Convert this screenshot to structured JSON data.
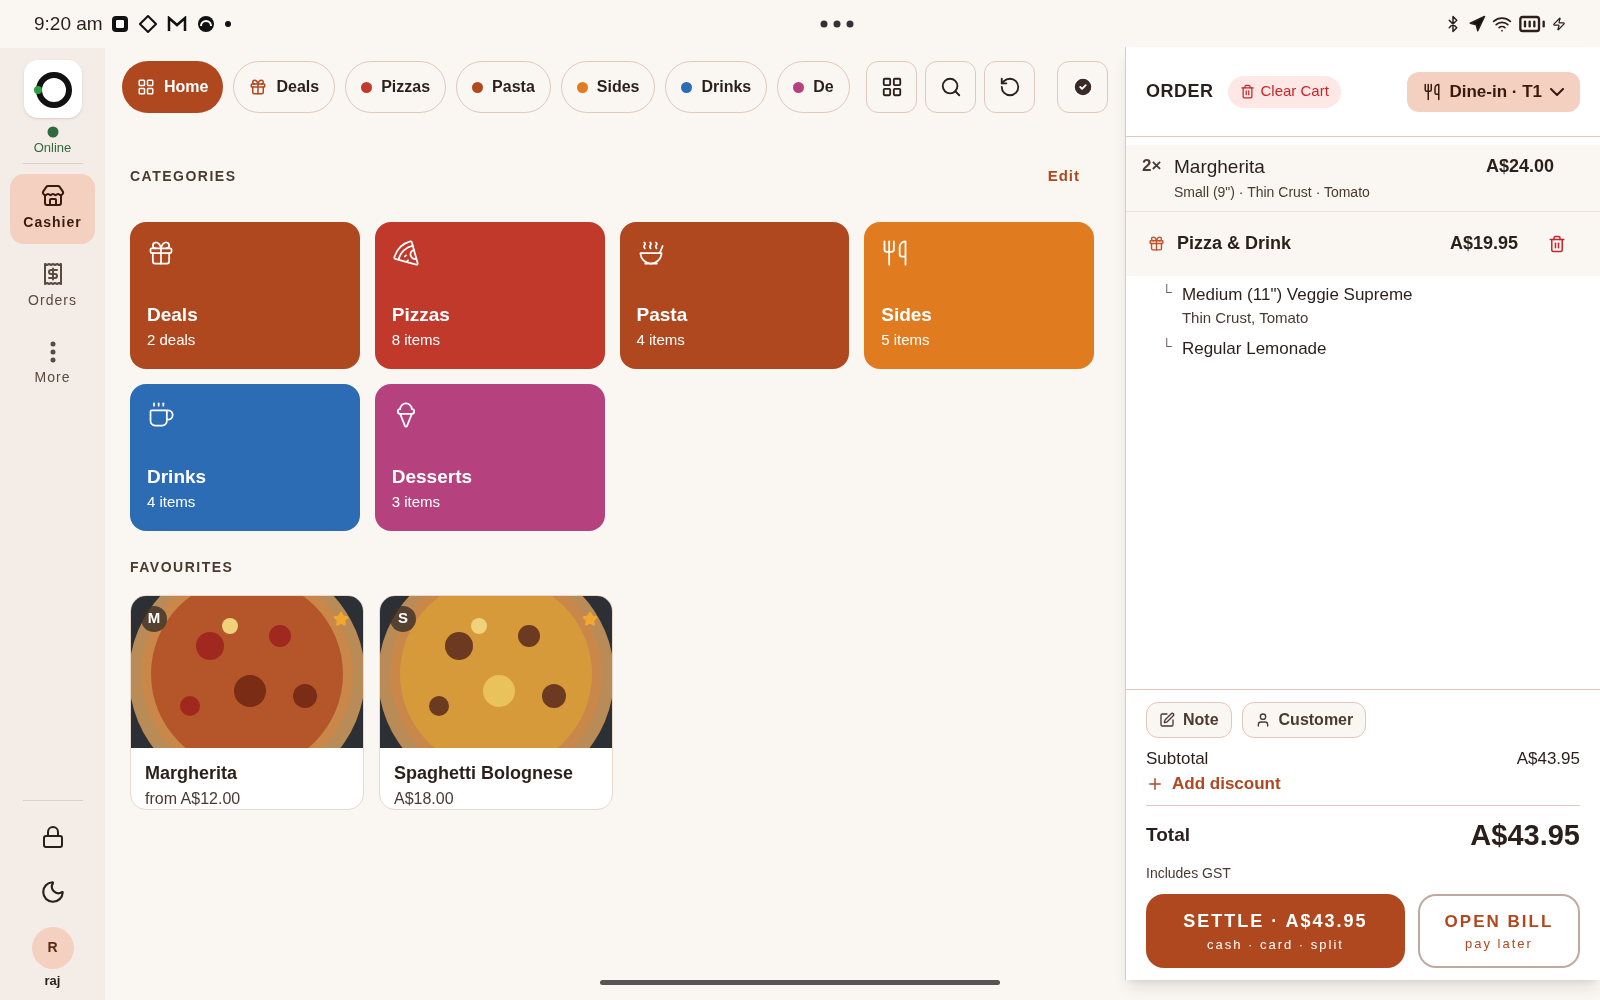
{
  "status_bar": {
    "time": "9:20 am"
  },
  "rail": {
    "status": "Online",
    "items": [
      {
        "label": "Cashier",
        "selected": true
      },
      {
        "label": "Orders",
        "selected": false
      },
      {
        "label": "More",
        "selected": false
      }
    ],
    "user": {
      "initial": "R",
      "name": "raj"
    }
  },
  "chips": [
    {
      "label": "Home",
      "kind": "icon",
      "selected": true
    },
    {
      "label": "Deals",
      "kind": "icon",
      "selected": false
    },
    {
      "label": "Pizzas",
      "kind": "dot",
      "color": "#c0392b",
      "selected": false
    },
    {
      "label": "Pasta",
      "kind": "dot",
      "color": "#b0481f",
      "selected": false
    },
    {
      "label": "Sides",
      "kind": "dot",
      "color": "#e07b20",
      "selected": false
    },
    {
      "label": "Drinks",
      "kind": "dot",
      "color": "#2b6cb5",
      "selected": false
    },
    {
      "label": "De",
      "kind": "dot",
      "color": "#b5427e",
      "selected": false
    }
  ],
  "categories": {
    "title": "CATEGORIES",
    "edit": "Edit",
    "items": [
      {
        "name": "Deals",
        "count": "2 deals",
        "color": "#b0481f"
      },
      {
        "name": "Pizzas",
        "count": "8 items",
        "color": "#c0392b"
      },
      {
        "name": "Pasta",
        "count": "4 items",
        "color": "#b0481f"
      },
      {
        "name": "Sides",
        "count": "5 items",
        "color": "#e07b20"
      },
      {
        "name": "Drinks",
        "count": "4 items",
        "color": "#2b6cb5"
      },
      {
        "name": "Desserts",
        "count": "3 items",
        "color": "#b5427e"
      }
    ]
  },
  "favourites": {
    "title": "FAVOURITES",
    "items": [
      {
        "badge": "M",
        "name": "Margherita",
        "price": "from A$12.00",
        "kind": "picture"
      },
      {
        "badge": "S",
        "name": "Spaghetti Bolognese",
        "price": "A$18.00",
        "kind": "picture"
      }
    ]
  },
  "order": {
    "title": "ORDER",
    "clear": "Clear Cart",
    "mode": "Dine-in · T1",
    "lines": [
      {
        "kind": "item",
        "qty": "2×",
        "name": "Margherita",
        "detail": "Small (9\") · Thin Crust · Tomato",
        "price": "A$24.00"
      },
      {
        "kind": "deal",
        "name": "Pizza & Drink",
        "price": "A$19.95",
        "children": [
          {
            "name": "Medium (11\") Veggie Supreme",
            "detail": "Thin Crust, Tomato",
            "mark": "└"
          },
          {
            "name": "Regular Lemonade",
            "mark": "└"
          }
        ]
      }
    ],
    "actions": [
      "Note",
      "Customer"
    ],
    "subtotal_label": "Subtotal",
    "subtotal": "A$43.95",
    "discount": "Add discount",
    "total_label": "Total",
    "total": "A$43.95",
    "tax_note": "Includes GST",
    "settle": {
      "label": "SETTLE · A$43.95",
      "sub": "cash · card · split"
    },
    "open_bill": {
      "label": "OPEN BILL",
      "sub": "pay later"
    }
  }
}
